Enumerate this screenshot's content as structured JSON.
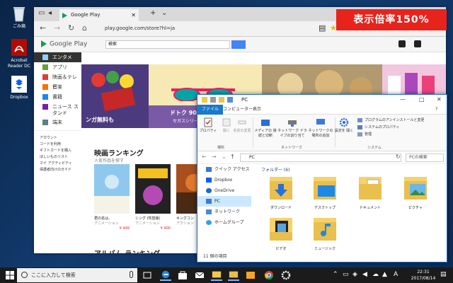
{
  "desktop": {
    "icons": [
      {
        "label": "ごみ箱"
      },
      {
        "label": "Acrobat Reader DC"
      },
      {
        "label": "Dropbox"
      }
    ]
  },
  "badge": {
    "text": "表示倍率150%"
  },
  "browser": {
    "tab_title": "Google Play",
    "url": "play.google.com/store?hl=ja",
    "logo": "Google Play",
    "search_value": "検索",
    "nav": [
      {
        "label": "エンタメ"
      },
      {
        "label": "アプリ"
      },
      {
        "label": "映画＆テレビ"
      },
      {
        "label": "音楽"
      },
      {
        "label": "書籍"
      },
      {
        "label": "ニュース スタンド"
      },
      {
        "label": "端末"
      }
    ],
    "links": [
      "アカウント",
      "コードを利用",
      "ギフトカードを購入",
      "ほしいものリスト",
      "マイ アクティビティ",
      "保護者向けのガイド"
    ],
    "banner_caption_1": "ンガ無料も",
    "banner_caption_2": "ドトク 90日間無",
    "banner_sub_2": "セガスシリー",
    "section_title": "映画ランキング",
    "section_sub": "人気作品を探す",
    "movies": [
      {
        "title": "君の名は。",
        "sub": "アニメーション",
        "price": "¥ 499"
      },
      {
        "title": "シング (吹替版)",
        "sub": "アニメーション",
        "price": "¥ 400"
      },
      {
        "title": "キングコン",
        "sub": "アクション",
        "price": "¥"
      }
    ],
    "section2": "アルバム ランキング"
  },
  "explorer": {
    "title": "PC",
    "tabs": [
      "ファイル",
      "コンピューター",
      "表示"
    ],
    "ribbon_buttons": [
      "プロパティ",
      "開く",
      "名前の変更",
      "メディアの 接続と切断",
      "ネットワーク ドライブの割り当て",
      "ネットワークの 場所の追加",
      "設定を 開く"
    ],
    "group_labels": [
      "場所",
      "ネットワーク",
      "システム"
    ],
    "system_items": [
      "プログラムのアンインストールと変更",
      "システムのプロパティ",
      "管理"
    ],
    "address": "PC",
    "search_placeholder": "PCの検索",
    "pane": [
      "クイック アクセス",
      "Dropbox",
      "OneDrive",
      "PC",
      "ネットワーク",
      "ホームグループ"
    ],
    "folders_header": "フォルダー (6)",
    "folders": [
      "ダウンロード",
      "デスクトップ",
      "ドキュメント",
      "ピクチャ",
      "ビデオ",
      "ミュージック"
    ],
    "status": "11 個の項目"
  },
  "taskbar": {
    "search_placeholder": "ここに入力して検索",
    "time": "22:31",
    "date": "2017/08/14"
  },
  "colors": {
    "badge": "#e8231c",
    "file_tab": "#1979ca",
    "selected_pane": "#cce8ff"
  }
}
